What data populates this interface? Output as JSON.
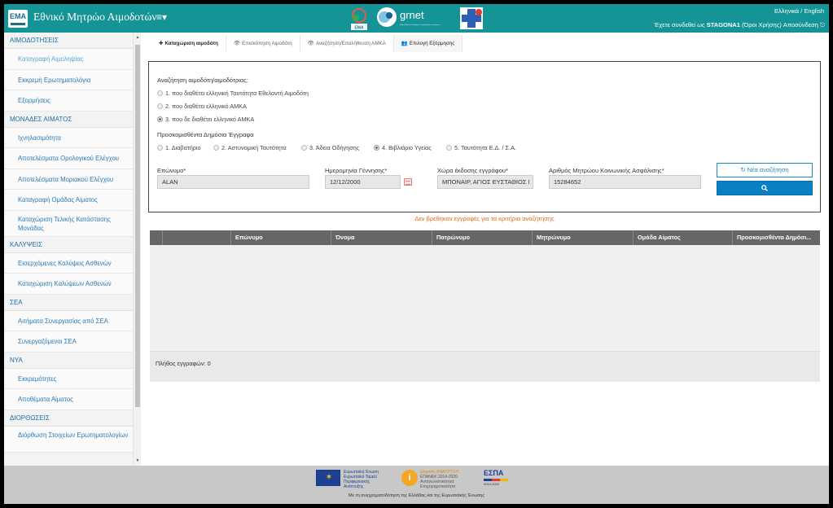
{
  "header": {
    "logo_text": "ΕΜΑ",
    "app_title": "Εθνικό Μητρώο Αιμοδοτών",
    "menu_icon": "≡▾",
    "lang_el": "Ελληνικά",
    "lang_sep": "/",
    "lang_en": "English",
    "login_prefix": "Έχετε συνδεθεί ως",
    "username": "STAGONA1",
    "terms": "(Όροι Χρήσης)",
    "logout": "Αποσύνδεση",
    "logout_icon": "⎋",
    "partner_logo_1": "ΕΜΑ",
    "partner_logo_2": "grnet",
    "partner_logo_2_sub": "Εθνικό Δίκτυο Υποδομών Τεχνολογίας και Έρευνας"
  },
  "sidebar": {
    "sections": [
      {
        "title": "ΑΙΜΟΔΟΤΗΣΕΙΣ",
        "items": [
          "Καταγραφή Αιμοληψίας",
          "Εκκρεμή Ερωτηματολόγια",
          "Εξορμήσεις"
        ]
      },
      {
        "title": "ΜΟΝΑΔΕΣ ΑΙΜΑΤΟΣ",
        "items": [
          "Ιχνηλασιμότητα",
          "Αποτελέσματα Ορολογικού Ελέγχου",
          "Αποτελέσματα Μοριακού Ελέγχου",
          "Καταγραφή Ομάδας Αίματος",
          "Καταχώριση Τελικής Κατάστασης Μονάδας"
        ]
      },
      {
        "title": "ΚΑΛΥΨΕΙΣ",
        "items": [
          "Εισερχόμενες Καλύψεις Ασθενών",
          "Καταχώριση Καλύψεων Ασθενών"
        ]
      },
      {
        "title": "ΣΕΑ",
        "items": [
          "Αιτήματα Συνεργασίας από ΣΕΑ",
          "Συνεργαζόμενοι ΣΕΑ"
        ]
      },
      {
        "title": "ΝΥΑ",
        "items": [
          "Εκκρεμότητες",
          "Αποθέματα Αίματος"
        ]
      },
      {
        "title": "ΔΙΟΡΘΩΣΕΙΣ",
        "items": [
          "Διόρθωση Στοιχείων Ερωτηματολογίων"
        ]
      }
    ]
  },
  "tabs": [
    {
      "icon": "✚",
      "label": "Καταχώριση αιμοδότη"
    },
    {
      "icon": "👁",
      "label": "Επισκόπηση Αιμοδότη"
    },
    {
      "icon": "👁",
      "label": "Αναζήτηση/Επαλήθευση ΑΜΚΑ"
    },
    {
      "icon": "👥",
      "label": "Επιλογή Εξόρμησης"
    }
  ],
  "search": {
    "title": "Αναζήτηση αιμοδότη/αιμοδότριας:",
    "search_options": [
      {
        "label": "1. που διαθέτει ελληνική Ταυτότητα Εθελοντή Αιμοδότη",
        "checked": false
      },
      {
        "label": "2. που διαθέτει ελληνικό ΑΜΚΑ",
        "checked": false
      },
      {
        "label": "3. που δε διαθέτει ελληνικό ΑΜΚΑ",
        "checked": true
      }
    ],
    "docs_title": "Προσκομισθέντα Δημόσια Έγγραφα",
    "doc_options": [
      {
        "label": "1. Διαβατήριο",
        "checked": false
      },
      {
        "label": "2. Αστυνομική Ταυτότητα",
        "checked": false
      },
      {
        "label": "3. Άδεια Οδήγησης",
        "checked": false
      },
      {
        "label": "4. Βιβλιάριο Υγείας",
        "checked": true
      },
      {
        "label": "5. Ταυτότητα Ε.Δ. / Σ.Α.",
        "checked": false
      }
    ],
    "fields": {
      "surname_label": "Επώνυμο*",
      "surname_value": "ALAN",
      "dob_label": "Ημερομηνία Γέννησης*",
      "dob_value": "12/12/2000",
      "country_label": "Χώρα έκδοσης εγγράφου*",
      "country_value": "ΜΠΟΝΑΙΡ, ΑΓΙΟΣ ΕΥΣΤΑΘΙΟΣ Ι",
      "amka_label": "Αριθμός Μητρώου Κοινωνικής Ασφάλισης*",
      "amka_value": "15284652"
    },
    "new_search_label": "↻ Νέα αναζήτηση",
    "search_icon": "🔍"
  },
  "no_results_text": "Δεν βρέθηκαν εγγραφές για τα κριτήρια αναζήτησης",
  "table": {
    "columns": [
      "",
      "",
      "Επώνυμο",
      "Όνομα",
      "Πατρώνυμο",
      "Μητρώνυμο",
      "Ομάδα Αίματος",
      "Προσκομισθέντα Δημόσι..."
    ],
    "count_label": "Πλήθος εγγραφών: 0"
  },
  "footer": {
    "eu_text": [
      "Ευρωπαϊκή Ένωση",
      "Ευρωπαϊκό Ταμείο",
      "Περιφερειακής",
      "Ανάπτυξης"
    ],
    "dig_text": [
      "ψηφιακή ΑΝΑΠΤΥΞΗ",
      "ΕΠΑΝΕΚ 2014-2020",
      "Ανταγωνιστικότητα",
      "Επιχειρηματικότητα"
    ],
    "espa_text": "ΕΣΠΑ",
    "espa_sub": "2014-2020",
    "cofund_text": "Με τη συγχρηματοδότηση της Ελλάδας και της Ευρωπαϊκής Ένωσης"
  },
  "colors": {
    "header": "#149497",
    "accent": "#0b7fc3",
    "notfound": "#e26a1a",
    "table_head": "#666666"
  }
}
